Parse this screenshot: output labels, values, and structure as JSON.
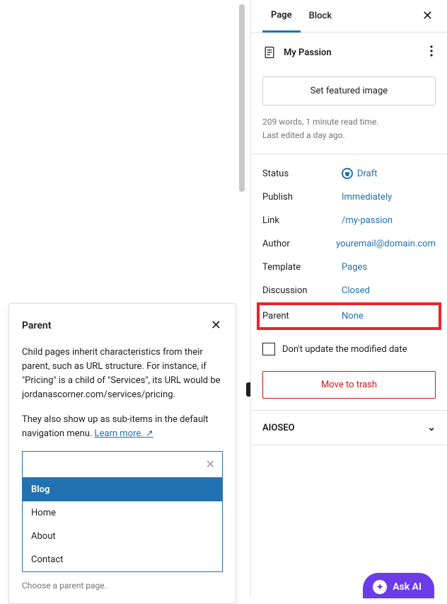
{
  "tabs": {
    "page": "Page",
    "block": "Block"
  },
  "page_header": {
    "title": "My Passion"
  },
  "featured_button": "Set featured image",
  "meta": {
    "line1": "209 words, 1 minute read time.",
    "line2": "Last edited a day ago."
  },
  "settings": {
    "status": {
      "label": "Status",
      "value": "Draft"
    },
    "publish": {
      "label": "Publish",
      "value": "Immediately"
    },
    "link": {
      "label": "Link",
      "value": "/my-passion"
    },
    "author": {
      "label": "Author",
      "value": "youremail@domain.com"
    },
    "template": {
      "label": "Template",
      "value": "Pages"
    },
    "discussion": {
      "label": "Discussion",
      "value": "Closed"
    },
    "parent": {
      "label": "Parent",
      "value": "None"
    }
  },
  "checkbox_label": "Don't update the modified date",
  "trash_button": "Move to trash",
  "aioseo_label": "AIOSEO",
  "popover": {
    "title": "Parent",
    "para1": "Child pages inherit characteristics from their parent, such as URL structure. For instance, if \"Pricing\" is a child of \"Services\", its URL would be jordanascorner.com/services/pricing.",
    "para2_prefix": "They also show up as sub-items in the default navigation menu. ",
    "learn_more": "Learn more. ↗",
    "options": [
      "Blog",
      "Home",
      "About",
      "Contact"
    ],
    "helper": "Choose a parent page."
  },
  "ask_ai": "Ask AI"
}
